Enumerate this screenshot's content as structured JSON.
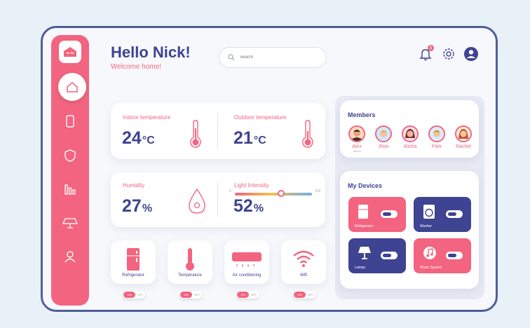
{
  "header": {
    "title": "Hello Nick!",
    "subtitle": "Welcome home!"
  },
  "search": {
    "placeholder": "Search"
  },
  "notifications": {
    "count": "1"
  },
  "sidebar": {
    "active_item": "home",
    "items": [
      "home",
      "devices",
      "security",
      "statistics",
      "lamps",
      "profile"
    ]
  },
  "indoor": {
    "label": "Indoor temperature",
    "value": "24",
    "unit": "°C"
  },
  "outdoor": {
    "label": "Outdoor temperature",
    "value": "21",
    "unit": "°C"
  },
  "humidity": {
    "label": "Humidity",
    "value": "27",
    "unit": "%"
  },
  "light": {
    "label": "Light Intensity",
    "value": "52",
    "unit": "%",
    "min_label": "0",
    "max_label": "100",
    "level": 0.6
  },
  "members": {
    "title": "Members",
    "items": [
      {
        "name": "Alex",
        "role": "Admin"
      },
      {
        "name": "Jhon"
      },
      {
        "name": "Alisha"
      },
      {
        "name": "Piter"
      },
      {
        "name": "Rachel"
      }
    ]
  },
  "my_devices": {
    "title": "My Devices",
    "items": [
      {
        "name": "Refrigerator",
        "color": "#f2647f"
      },
      {
        "name": "Washer",
        "color": "#3e4392"
      },
      {
        "name": "Lamps",
        "color": "#3e4392"
      },
      {
        "name": "Music System",
        "color": "#f2647f"
      }
    ]
  },
  "appliances": {
    "items": [
      {
        "name": "Refrigerator",
        "on_label": "ON",
        "off_label": "OFF"
      },
      {
        "name": "Temperature",
        "on_label": "ON",
        "off_label": "OFF"
      },
      {
        "name": "Air conditioning",
        "on_label": "ON",
        "off_label": "OFF"
      },
      {
        "name": "Wifi",
        "on_label": "ON",
        "off_label": "OFF"
      }
    ]
  },
  "colors": {
    "accent": "#f2647f",
    "primary": "#3e4392",
    "background": "#f7f8fc"
  }
}
